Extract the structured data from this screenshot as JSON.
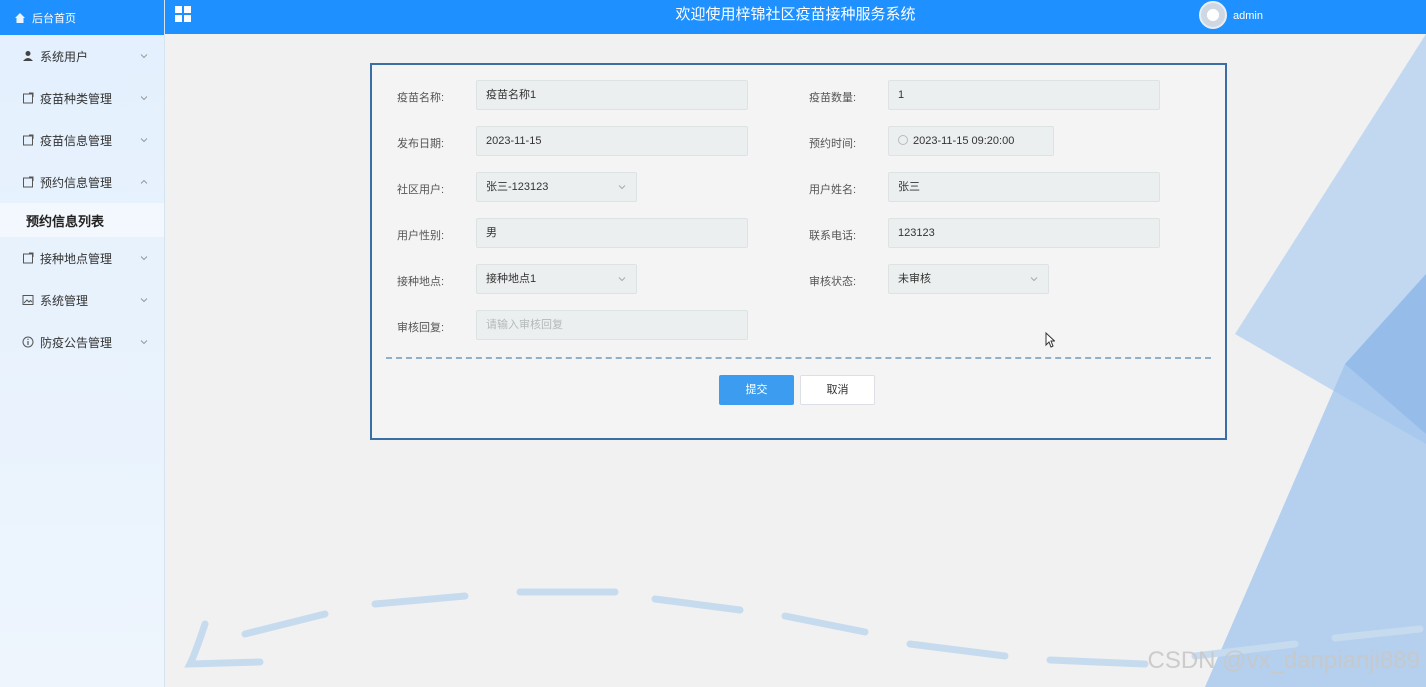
{
  "sidebar": {
    "home_label": "后台首页",
    "items": [
      {
        "label": "系统用户",
        "icon": "user-icon"
      },
      {
        "label": "疫苗种类管理",
        "icon": "document-icon"
      },
      {
        "label": "疫苗信息管理",
        "icon": "document-icon"
      },
      {
        "label": "预约信息管理",
        "icon": "document-icon",
        "expanded": true
      },
      {
        "label": "接种地点管理",
        "icon": "document-icon"
      },
      {
        "label": "系统管理",
        "icon": "image-icon"
      },
      {
        "label": "防疫公告管理",
        "icon": "info-icon"
      }
    ],
    "submenu": {
      "label": "预约信息列表"
    }
  },
  "header": {
    "title": "欢迎使用梓锦社区疫苗接种服务系统",
    "username": "admin",
    "color": "#1e90ff"
  },
  "form": {
    "vaccine_name": {
      "label": "疫苗名称:",
      "value": "疫苗名称1"
    },
    "vaccine_qty": {
      "label": "疫苗数量:",
      "value": "1"
    },
    "publish_date": {
      "label": "发布日期:",
      "value": "2023-11-15"
    },
    "appointment_time": {
      "label": "预约时间:",
      "value": "2023-11-15 09:20:00"
    },
    "community_user": {
      "label": "社区用户:",
      "value": "张三-123123"
    },
    "user_name": {
      "label": "用户姓名:",
      "value": "张三"
    },
    "user_gender": {
      "label": "用户性别:",
      "value": "男"
    },
    "phone": {
      "label": "联系电话:",
      "value": "123123"
    },
    "site": {
      "label": "接种地点:",
      "value": "接种地点1"
    },
    "review_status": {
      "label": "审核状态:",
      "value": "未审核"
    },
    "review_reply": {
      "label": "审核回复:",
      "placeholder": "请输入审核回复"
    },
    "submit_label": "提交",
    "cancel_label": "取消"
  },
  "watermark": "CSDN @vx_danpianji889"
}
